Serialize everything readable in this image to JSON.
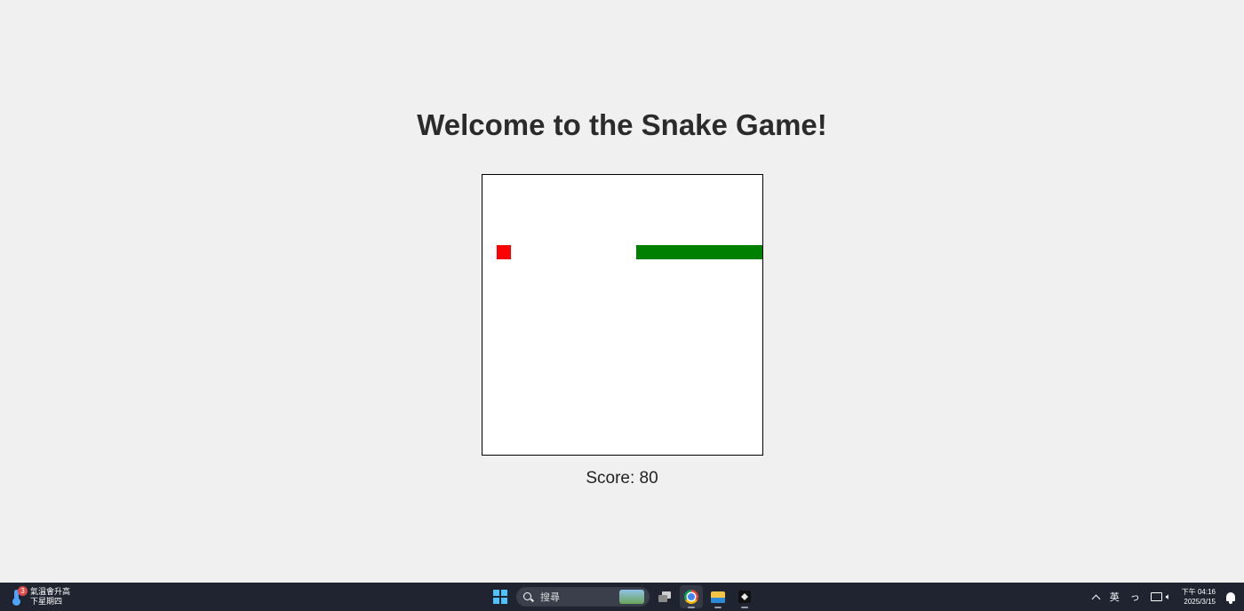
{
  "page": {
    "title": "Welcome to the Snake Game!",
    "score_label": "Score: 80"
  },
  "game": {
    "board_background": "#ffffff",
    "board_border": "#000000",
    "grid_cells": 20,
    "food": {
      "color": "#ff0000",
      "col": 1,
      "row": 5
    },
    "snake": {
      "color": "#008000",
      "row": 5,
      "cols": [
        11,
        12,
        13,
        14,
        15,
        16,
        17,
        18,
        19
      ],
      "score": 80
    }
  },
  "taskbar": {
    "weather": {
      "icon": "thermometer-icon",
      "badge": "3",
      "line1": "氣溫會升高",
      "line2": "下星期四"
    },
    "search": {
      "placeholder": "搜尋"
    },
    "apps": [
      {
        "name": "task-view-icon"
      },
      {
        "name": "chrome-icon"
      },
      {
        "name": "file-explorer-icon"
      },
      {
        "name": "app-cube-icon"
      }
    ],
    "tray": {
      "ime": "英",
      "clock_time": "下午 04:16",
      "clock_date": "2025/3/15"
    },
    "background": "#1f2430"
  }
}
